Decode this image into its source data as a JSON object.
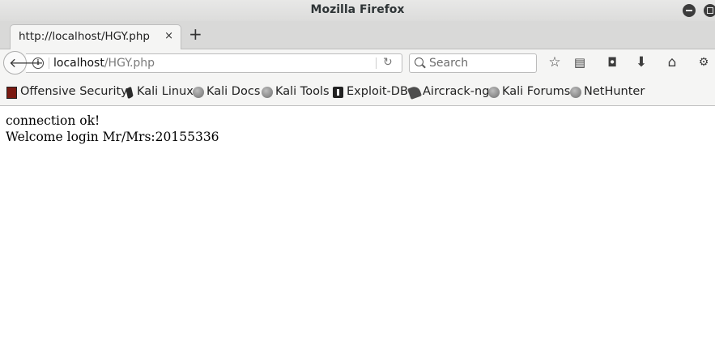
{
  "window": {
    "title": "Mozilla Firefox"
  },
  "tab": {
    "title": "http://localhost/HGY.php",
    "close": "×",
    "new_tab": "+"
  },
  "navbar": {
    "url_host": "localhost",
    "url_path": "/HGY.php",
    "search_placeholder": "Search",
    "toolbar_icons": [
      "star-icon",
      "reading-list-icon",
      "pocket-icon",
      "download-icon",
      "home-icon",
      "extension-icon"
    ]
  },
  "bookmarks": [
    {
      "label": "Offensive Security",
      "icon": "offsec-icon"
    },
    {
      "label": "Kali Linux",
      "icon": "kali-dragon-icon"
    },
    {
      "label": "Kali Docs",
      "icon": "globe-icon"
    },
    {
      "label": "Kali Tools",
      "icon": "globe-icon"
    },
    {
      "label": "Exploit-DB",
      "icon": "exploit-db-icon"
    },
    {
      "label": "Aircrack-ng",
      "icon": "aircrack-icon"
    },
    {
      "label": "Kali Forums",
      "icon": "globe-icon"
    },
    {
      "label": "NetHunter",
      "icon": "globe-icon"
    }
  ],
  "page": {
    "line1": "connection ok!",
    "line2": "Welcome login Mr/Mrs:20155336"
  }
}
